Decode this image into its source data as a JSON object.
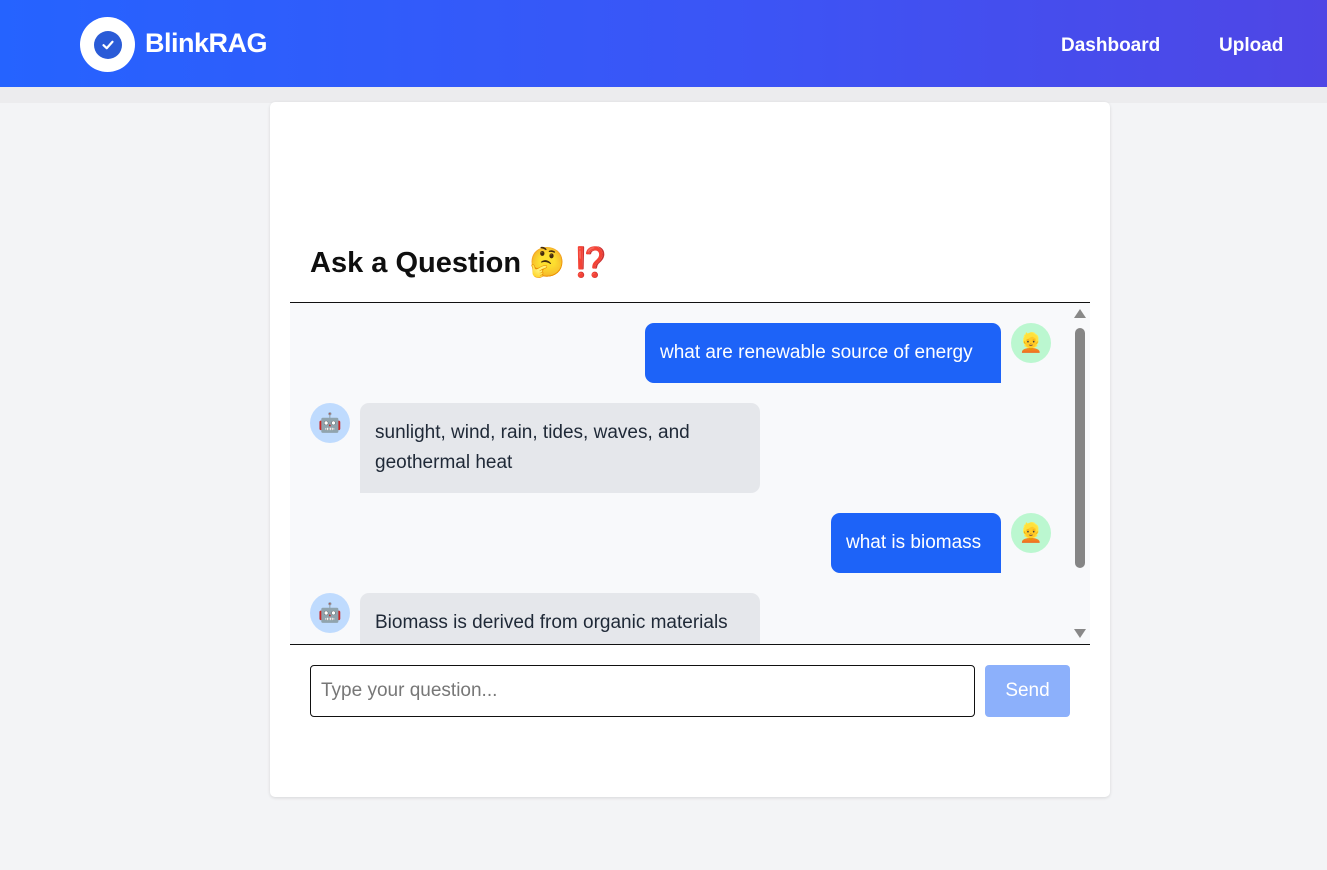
{
  "app": {
    "brand": "BlinkRAG"
  },
  "nav": {
    "dashboard": "Dashboard",
    "upload": "Upload"
  },
  "chat": {
    "title": "Ask a Question",
    "title_emoji_1": "🤔",
    "title_emoji_2": "⁉️",
    "messages": [
      {
        "role": "user",
        "text": "what are renewable source of energy",
        "avatar": "👱"
      },
      {
        "role": "bot",
        "text": "sunlight, wind, rain, tides, waves, and geothermal heat",
        "avatar": "🤖"
      },
      {
        "role": "user",
        "text": "what is biomass",
        "avatar": "👱"
      },
      {
        "role": "bot",
        "text": "Biomass is derived from organic materials",
        "avatar": "🤖"
      }
    ],
    "input_placeholder": "Type your question...",
    "send_label": "Send"
  },
  "colors": {
    "nav_gradient_start": "#2563ff",
    "nav_gradient_end": "#4f46e5",
    "user_bubble": "#1d63f8",
    "bot_bubble": "#e5e7eb",
    "send_button": "#8cb0fb"
  }
}
